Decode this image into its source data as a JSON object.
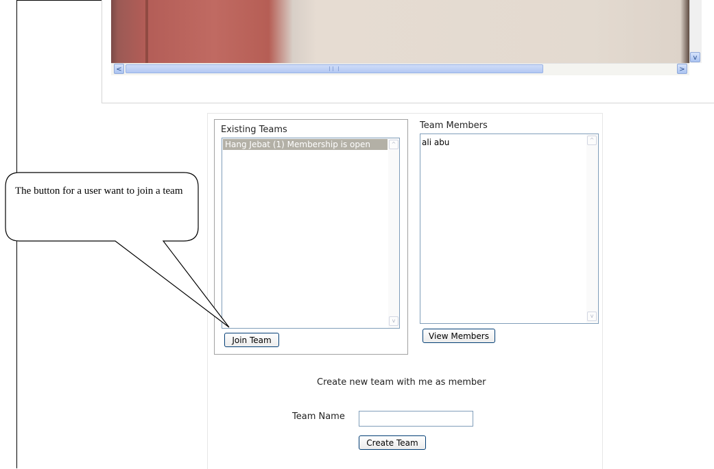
{
  "teams_panel": {
    "existing_label": "Existing Teams",
    "existing_teams": [
      "Hang Jebat (1) Membership is open"
    ],
    "join_button": "Join Team",
    "members_label": "Team Members",
    "members": [
      "ali abu"
    ],
    "view_members_button": "View Members"
  },
  "create_team": {
    "heading": "Create new team with me as member",
    "name_label": "Team Name",
    "name_value": "",
    "create_button": "Create Team"
  },
  "callout": {
    "text": "The button for a user want to join a team"
  },
  "scrollbar": {
    "left_arrow": "<",
    "right_arrow": ">",
    "down_arrow": "v",
    "up_arrow": "^"
  }
}
